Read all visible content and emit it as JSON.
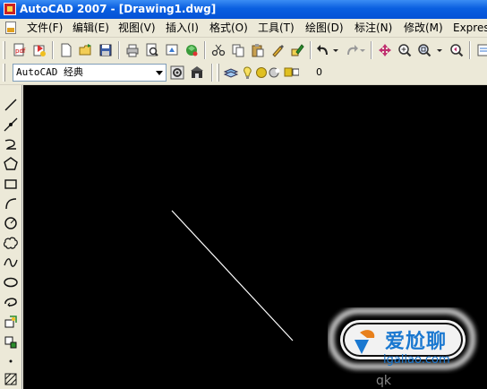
{
  "window": {
    "title": "AutoCAD 2007 - [Drawing1.dwg]"
  },
  "menu": {
    "items": [
      "文件(F)",
      "编辑(E)",
      "视图(V)",
      "插入(I)",
      "格式(O)",
      "工具(T)",
      "绘图(D)",
      "标注(N)",
      "修改(M)",
      "Expres"
    ]
  },
  "toolbar": {
    "workspace_value": "AutoCAD 经典",
    "layer_value": "0"
  },
  "watermark": {
    "chinese_text": "爱尬聊",
    "url_text": "igaliao.com",
    "bottom_text": "qk"
  },
  "colors": {
    "titlebar": "#0a5fe0",
    "canvas": "#000000",
    "chrome": "#ece9d8",
    "watermark_orange": "#e8801c",
    "watermark_blue": "#1a78d0"
  }
}
